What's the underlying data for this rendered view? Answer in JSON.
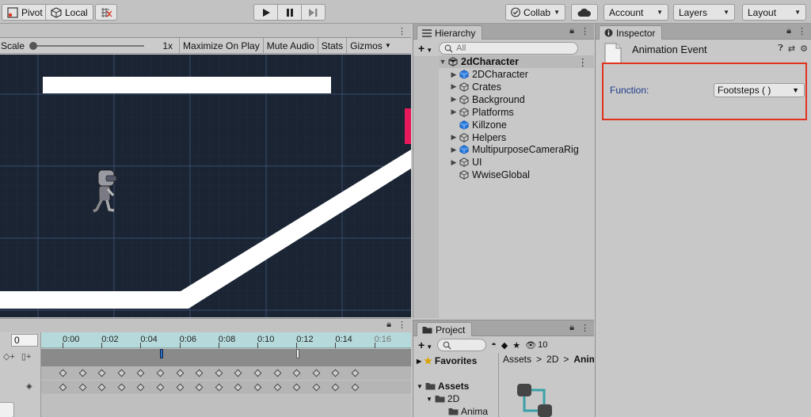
{
  "toolbar": {
    "pivot": "Pivot",
    "local": "Local",
    "collab": "Collab",
    "account": "Account",
    "layers": "Layers",
    "layout": "Layout"
  },
  "scene": {
    "scale_label": "Scale",
    "scale_value": "1x",
    "maximize": "Maximize On Play",
    "mute": "Mute Audio",
    "stats": "Stats",
    "gizmos": "Gizmos"
  },
  "hierarchy": {
    "tab": "Hierarchy",
    "search_placeholder": "All",
    "root": "2dCharacter",
    "items": [
      {
        "label": "2DCharacter",
        "icon": "cube-blue"
      },
      {
        "label": "Crates",
        "icon": "cube-outline"
      },
      {
        "label": "Background",
        "icon": "cube-outline"
      },
      {
        "label": "Platforms",
        "icon": "cube-outline"
      },
      {
        "label": "Killzone",
        "icon": "cube-blue"
      },
      {
        "label": "Helpers",
        "icon": "cube-outline"
      },
      {
        "label": "MultipurposeCameraRig",
        "icon": "cube-blue"
      },
      {
        "label": "UI",
        "icon": "cube-outline"
      },
      {
        "label": "WwiseGlobal",
        "icon": "cube-outline"
      }
    ]
  },
  "inspector": {
    "tab": "Inspector",
    "title": "Animation Event",
    "function_label": "Function:",
    "function_value": "Footsteps ( )"
  },
  "animation": {
    "frame": "0",
    "ticks": [
      "0:00",
      "0:02",
      "0:04",
      "0:06",
      "0:08",
      "0:10",
      "0:12",
      "0:14",
      "0:16"
    ]
  },
  "project": {
    "tab": "Project",
    "count": "10",
    "favorites": "Favorites",
    "assets": "Assets",
    "folder_2d": "2D",
    "folder_anim": "Anima",
    "breadcrumb": [
      "Assets",
      "2D",
      "Anim"
    ]
  },
  "colors": {
    "highlight": "#e0321e",
    "scene_bg": "#1a2433",
    "prefab_blue": "#2a7de1",
    "killzone": "#e8195a"
  }
}
